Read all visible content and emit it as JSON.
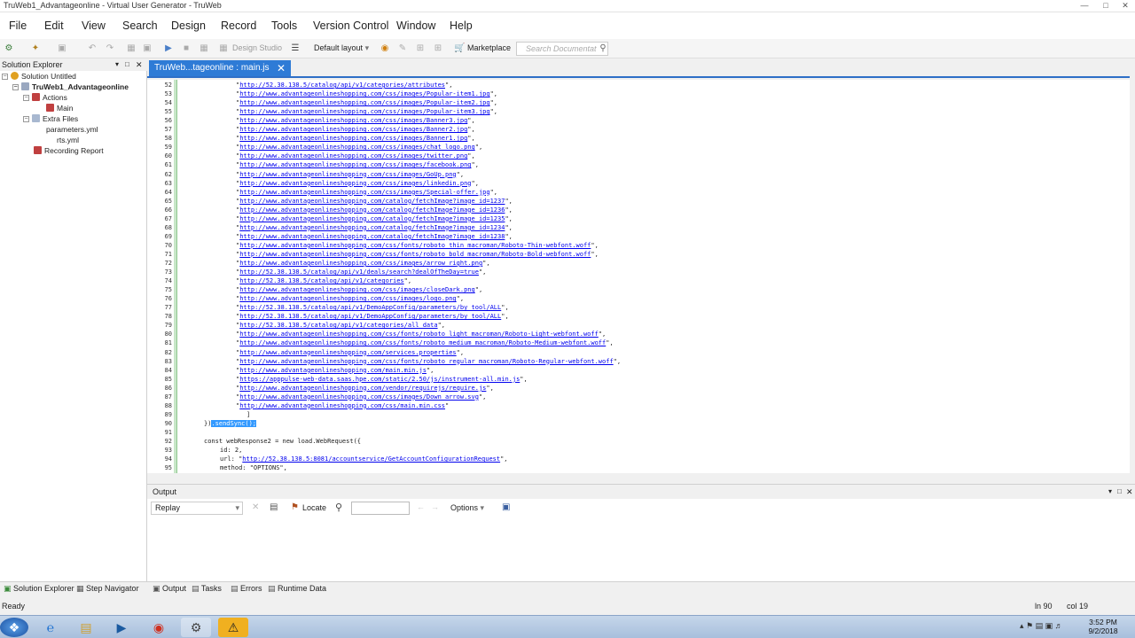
{
  "window": {
    "title": "TruWeb1_Advantageonline - Virtual User Generator - TruWeb"
  },
  "menu": [
    "File",
    "Edit",
    "View",
    "Search",
    "Design",
    "Record",
    "Tools",
    "Version Control",
    "Window",
    "Help"
  ],
  "toolbar": {
    "design_studio": "Design Studio",
    "layout": "Default layout",
    "marketplace": "Marketplace",
    "search_placeholder": "Search Documentat"
  },
  "solution_explorer": {
    "title": "Solution Explorer",
    "items": [
      {
        "label": "Solution Untitled"
      },
      {
        "label": "TruWeb1_Advantageonline"
      },
      {
        "label": "Actions"
      },
      {
        "label": "Main"
      },
      {
        "label": "Extra Files"
      },
      {
        "label": "parameters.yml"
      },
      {
        "label": "rts.yml"
      },
      {
        "label": "Recording Report"
      }
    ]
  },
  "editor": {
    "tab_label": "TruWeb...tageonline : main.js",
    "lines": [
      {
        "n": "52",
        "text": "\"http://52.38.138.5/catalog/api/v1/categories/attributes\","
      },
      {
        "n": "53",
        "text": "\"http://www.advantageonlineshopping.com/css/images/Popular-item1.jpg\","
      },
      {
        "n": "54",
        "text": "\"http://www.advantageonlineshopping.com/css/images/Popular-item2.jpg\","
      },
      {
        "n": "55",
        "text": "\"http://www.advantageonlineshopping.com/css/images/Popular-item3.jpg\","
      },
      {
        "n": "56",
        "text": "\"http://www.advantageonlineshopping.com/css/images/Banner3.jpg\","
      },
      {
        "n": "57",
        "text": "\"http://www.advantageonlineshopping.com/css/images/Banner2.jpg\","
      },
      {
        "n": "58",
        "text": "\"http://www.advantageonlineshopping.com/css/images/Banner1.jpg\","
      },
      {
        "n": "59",
        "text": "\"http://www.advantageonlineshopping.com/css/images/chat_logo.png\","
      },
      {
        "n": "60",
        "text": "\"http://www.advantageonlineshopping.com/css/images/twitter.png\","
      },
      {
        "n": "61",
        "text": "\"http://www.advantageonlineshopping.com/css/images/facebook.png\","
      },
      {
        "n": "62",
        "text": "\"http://www.advantageonlineshopping.com/css/images/GoUp.png\","
      },
      {
        "n": "63",
        "text": "\"http://www.advantageonlineshopping.com/css/images/linkedin.png\","
      },
      {
        "n": "64",
        "text": "\"http://www.advantageonlineshopping.com/css/images/Special-offer.jpg\","
      },
      {
        "n": "65",
        "text": "\"http://www.advantageonlineshopping.com/catalog/fetchImage?image_id=1237\","
      },
      {
        "n": "66",
        "text": "\"http://www.advantageonlineshopping.com/catalog/fetchImage?image_id=1236\","
      },
      {
        "n": "67",
        "text": "\"http://www.advantageonlineshopping.com/catalog/fetchImage?image_id=1235\","
      },
      {
        "n": "68",
        "text": "\"http://www.advantageonlineshopping.com/catalog/fetchImage?image_id=1234\","
      },
      {
        "n": "69",
        "text": "\"http://www.advantageonlineshopping.com/catalog/fetchImage?image_id=1238\","
      },
      {
        "n": "70",
        "text": "\"http://www.advantageonlineshopping.com/css/fonts/roboto_thin_macroman/Roboto-Thin-webfont.woff\","
      },
      {
        "n": "71",
        "text": "\"http://www.advantageonlineshopping.com/css/fonts/roboto_bold_macroman/Roboto-Bold-webfont.woff\","
      },
      {
        "n": "72",
        "text": "\"http://www.advantageonlineshopping.com/css/images/arrow_right.png\","
      },
      {
        "n": "73",
        "text": "\"http://52.38.138.5/catalog/api/v1/deals/search?dealOfTheDay=true\","
      },
      {
        "n": "74",
        "text": "\"http://52.38.138.5/catalog/api/v1/categories\","
      },
      {
        "n": "75",
        "text": "\"http://www.advantageonlineshopping.com/css/images/closeDark.png\","
      },
      {
        "n": "76",
        "text": "\"http://www.advantageonlineshopping.com/css/images/logo.png\","
      },
      {
        "n": "77",
        "text": "\"http://52.38.138.5/catalog/api/v1/DemoAppConfig/parameters/by_tool/ALL\","
      },
      {
        "n": "78",
        "text": "\"http://52.38.138.5/catalog/api/v1/DemoAppConfig/parameters/by_tool/ALL\","
      },
      {
        "n": "79",
        "text": "\"http://52.38.138.5/catalog/api/v1/categories/all_data\","
      },
      {
        "n": "80",
        "text": "\"http://www.advantageonlineshopping.com/css/fonts/roboto_light_macroman/Roboto-Light-webfont.woff\","
      },
      {
        "n": "81",
        "text": "\"http://www.advantageonlineshopping.com/css/fonts/roboto_medium_macroman/Roboto-Medium-webfont.woff\","
      },
      {
        "n": "82",
        "text": "\"http://www.advantageonlineshopping.com/services.properties\","
      },
      {
        "n": "83",
        "text": "\"http://www.advantageonlineshopping.com/css/fonts/roboto_regular_macroman/Roboto-Regular-webfont.woff\","
      },
      {
        "n": "84",
        "text": "\"http://www.advantageonlineshopping.com/main.min.js\","
      },
      {
        "n": "85",
        "text": "\"https://apppulse-web-data.saas.hpe.com/static/2.50/js/instrument-all.min.js\","
      },
      {
        "n": "86",
        "text": "\"http://www.advantageonlineshopping.com/vendor/requirejs/require.js\","
      },
      {
        "n": "87",
        "text": "\"http://www.advantageonlineshopping.com/css/images/Down_arrow.svg\","
      },
      {
        "n": "88",
        "text": "\"http://www.advantageonlineshopping.com/css/main.min.css\""
      },
      {
        "n": "89",
        "text": "]"
      },
      {
        "n": "90",
        "text": "}).sendSync();"
      },
      {
        "n": "91",
        "text": ""
      },
      {
        "n": "92",
        "text": "const webResponse2 = new load.WebRequest({"
      },
      {
        "n": "93",
        "text": "id: 2,"
      },
      {
        "n": "94",
        "text": "url: \"http://52.38.138.5:8081/accountservice/GetAccountConfigurationRequest\","
      },
      {
        "n": "95",
        "text": "method: \"OPTIONS\","
      }
    ]
  },
  "output": {
    "title": "Output",
    "source": "Replay",
    "locate": "Locate",
    "options": "Options"
  },
  "bottom_tabs": {
    "solution_explorer": "Solution Explorer",
    "step_navigator": "Step Navigator",
    "output": "Output",
    "tasks": "Tasks",
    "errors": "Errors",
    "runtime_data": "Runtime Data"
  },
  "status": {
    "text": "Ready",
    "ln": "ln 90",
    "col": "col 19"
  },
  "clock": {
    "time": "3:52 PM",
    "date": "9/2/2018"
  }
}
